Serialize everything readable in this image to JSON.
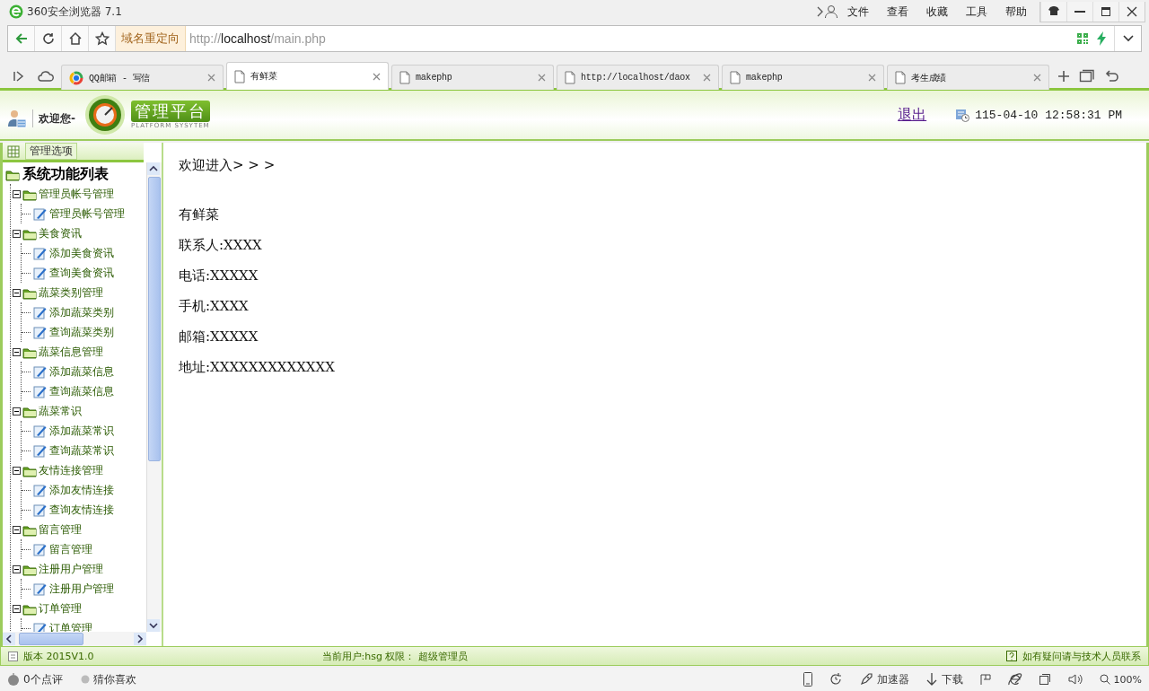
{
  "browser": {
    "title": "360安全浏览器 7.1",
    "menu": [
      "文件",
      "查看",
      "收藏",
      "工具",
      "帮助"
    ],
    "redirect_badge": "域名重定向",
    "url": {
      "scheme": "http://",
      "host": "localhost",
      "path": "/main.php"
    },
    "tabs": [
      {
        "label": "QQ邮箱 - 写信",
        "kind": "qq",
        "selected": false
      },
      {
        "label": "有鲜菜",
        "kind": "page",
        "selected": true
      },
      {
        "label": "makephp",
        "kind": "page",
        "selected": false
      },
      {
        "label": "http://localhost/daox",
        "kind": "page",
        "selected": false
      },
      {
        "label": "makephp",
        "kind": "page",
        "selected": false
      },
      {
        "label": "考生成绩",
        "kind": "page",
        "selected": false
      }
    ]
  },
  "header": {
    "welcome": "欢迎您-",
    "logo_title": "管理平台",
    "logo_subtitle": "PLATFORM SYSYTEM",
    "logout": "退出",
    "datetime": "115-04-10 12:58:31 PM"
  },
  "sidebar": {
    "tab": "管理选项",
    "tree_title": "系统功能列表",
    "sections": [
      {
        "label": "管理员帐号管理",
        "expanded": true,
        "children": [
          {
            "label": "管理员帐号管理"
          }
        ]
      },
      {
        "label": "美食资讯",
        "expanded": true,
        "children": [
          {
            "label": "添加美食资讯"
          },
          {
            "label": "查询美食资讯"
          }
        ]
      },
      {
        "label": "蔬菜类别管理",
        "expanded": true,
        "children": [
          {
            "label": "添加蔬菜类别"
          },
          {
            "label": "查询蔬菜类别"
          }
        ]
      },
      {
        "label": "蔬菜信息管理",
        "expanded": true,
        "children": [
          {
            "label": "添加蔬菜信息"
          },
          {
            "label": "查询蔬菜信息"
          }
        ]
      },
      {
        "label": "蔬菜常识",
        "expanded": true,
        "children": [
          {
            "label": "添加蔬菜常识"
          },
          {
            "label": "查询蔬菜常识"
          }
        ]
      },
      {
        "label": "友情连接管理",
        "expanded": true,
        "children": [
          {
            "label": "添加友情连接"
          },
          {
            "label": "查询友情连接"
          }
        ]
      },
      {
        "label": "留言管理",
        "expanded": true,
        "children": [
          {
            "label": "留言管理"
          }
        ]
      },
      {
        "label": "注册用户管理",
        "expanded": true,
        "children": [
          {
            "label": "注册用户管理"
          }
        ]
      },
      {
        "label": "订单管理",
        "expanded": true,
        "children": [
          {
            "label": "订单管理"
          }
        ]
      }
    ]
  },
  "content": {
    "breadcrumb": "欢迎进入> > >",
    "lines": [
      "有鲜菜",
      "联系人:XXXX",
      "电话:XXXXX",
      "手机:XXXX",
      "邮箱:XXXXX",
      "地址:XXXXXXXXXXXXX"
    ]
  },
  "footer": {
    "version": "版本 2015V1.0",
    "user": "当前用户:hsg 权限： 超级管理员",
    "help": "如有疑问请与技术人员联系"
  },
  "status_bar": {
    "reviews": "0个点评",
    "recommend": "猜你喜欢",
    "accelerator": "加速器",
    "download": "下载",
    "zoom": "100%"
  }
}
